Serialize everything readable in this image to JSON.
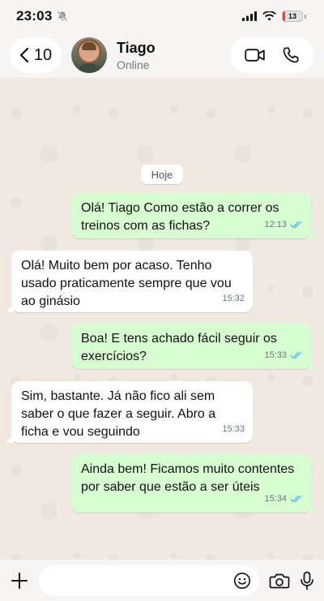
{
  "status_bar": {
    "time": "23:03",
    "battery_level": "13",
    "battery_fraction": 0.13,
    "battery_color": "#e8413c"
  },
  "header": {
    "back_count": "10",
    "contact_name": "Tiago",
    "contact_status": "Online",
    "icons": [
      "chevron-left-icon",
      "video-call-icon",
      "phone-icon"
    ]
  },
  "date_chip": "Hoje",
  "messages": [
    {
      "direction": "out",
      "text": "Olá! Tiago Como estão a correr os treinos com as fichas?",
      "time": "12:13",
      "read": true
    },
    {
      "direction": "in",
      "text": "Olá! Muito bem por acaso. Tenho usado praticamente sempre que vou ao ginásio",
      "time": "15:32"
    },
    {
      "direction": "out",
      "text": "Boa! E tens achado fácil seguir os exercícios?",
      "time": "15:33",
      "read": true
    },
    {
      "direction": "in",
      "text": "Sim, bastante. Já não fico ali sem saber o que fazer a seguir. Abro a ficha e vou seguindo",
      "time": "15:33"
    },
    {
      "direction": "out",
      "text": "Ainda bem! Ficamos muito contentes por saber que estão a ser úteis",
      "time": "15:34",
      "read": true
    }
  ],
  "input_bar": {
    "message_value": "",
    "icons": [
      "plus-icon",
      "emoji-icon",
      "camera-icon",
      "microphone-icon"
    ]
  },
  "colors": {
    "outgoing_bubble": "#d9fdd3",
    "incoming_bubble": "#ffffff",
    "read_ticks": "#53bdeb",
    "chat_background": "#efe9df"
  }
}
